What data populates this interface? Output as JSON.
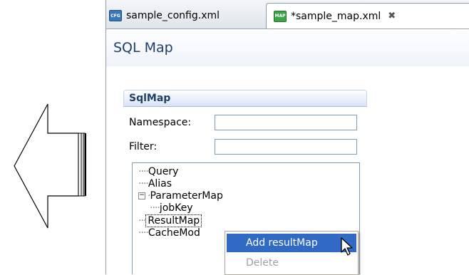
{
  "tabs": [
    {
      "label": "sample_config.xml",
      "icon": "cfg-file-icon",
      "icon_text": "CFG",
      "active": false
    },
    {
      "label": "*sample_map.xml",
      "icon": "map-file-icon",
      "icon_text": "MAP",
      "active": true
    }
  ],
  "editor": {
    "title": "SQL Map",
    "section_title": "SqlMap",
    "namespace_label": "Namespace:",
    "namespace_value": "",
    "filter_label": "Filter:",
    "filter_value": ""
  },
  "tree": {
    "items": [
      {
        "label": "Query"
      },
      {
        "label": "Alias"
      },
      {
        "label": "ParameterMap",
        "expanded": true
      },
      {
        "label": "jobKey"
      },
      {
        "label": "ResultMap",
        "selected": true
      },
      {
        "label": "CacheMod"
      }
    ]
  },
  "context_menu": {
    "items": [
      {
        "label": "Add resultMap",
        "enabled": true
      },
      {
        "label": "Delete",
        "enabled": false
      }
    ]
  },
  "colors": {
    "selection": "#316ac5",
    "title_text": "#1f3f66",
    "input_border": "#7f9db9"
  }
}
